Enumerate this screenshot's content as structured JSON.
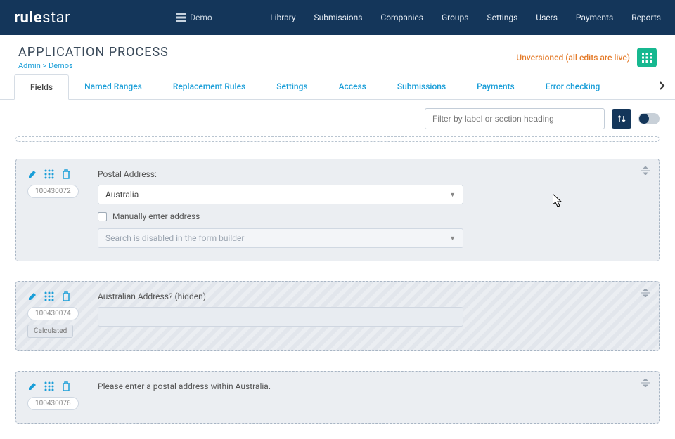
{
  "logo": {
    "bold": "rule",
    "light": "star"
  },
  "demo_label": "Demo",
  "nav": [
    "Library",
    "Submissions",
    "Companies",
    "Groups",
    "Settings",
    "Users",
    "Payments",
    "Reports"
  ],
  "page": {
    "title": "APPLICATION PROCESS"
  },
  "breadcrumb": {
    "a": "Admin",
    "sep": " > ",
    "b": "Demos"
  },
  "version_status": "Unversioned (all edits are live)",
  "tabs": [
    "Fields",
    "Named Ranges",
    "Replacement Rules",
    "Settings",
    "Access",
    "Submissions",
    "Payments",
    "Error checking"
  ],
  "filter_placeholder": "Filter by label or section heading",
  "cards": {
    "postal": {
      "id": "100430072",
      "label": "Postal Address:",
      "country_value": "Australia",
      "manual_label": "Manually enter address",
      "search_disabled": "Search is disabled in the form builder"
    },
    "aushidden": {
      "id": "100430074",
      "label": "Australian Address? (hidden)",
      "badge": "Calculated"
    },
    "pleaseenter": {
      "id": "100430076",
      "label": "Please enter a postal address within Australia."
    }
  }
}
